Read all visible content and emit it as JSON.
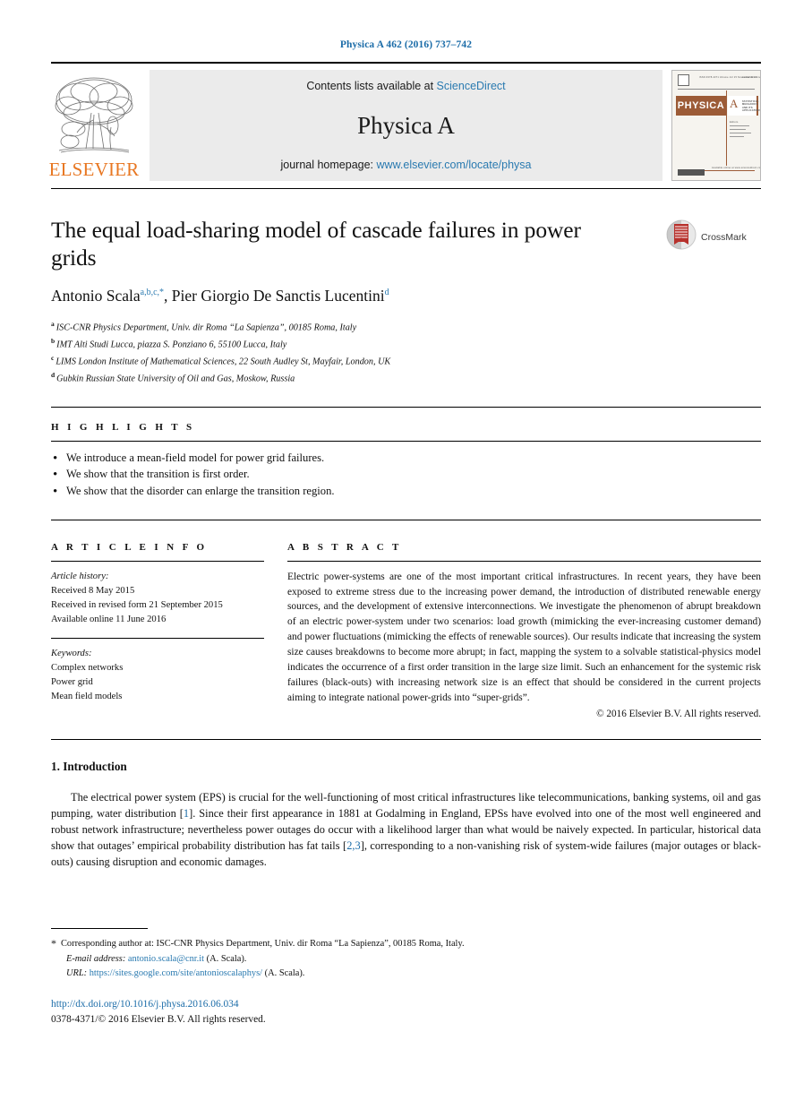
{
  "running_head": "Physica A 462 (2016) 737–742",
  "masthead": {
    "contents_prefix": "Contents lists available at ",
    "contents_link": "ScienceDirect",
    "journal_name": "Physica A",
    "homepage_prefix": "journal homepage: ",
    "homepage_link": "www.elsevier.com/locate/physa",
    "publisher_wordmark": "ELSEVIER",
    "cover_physica": "PHYSICA",
    "cover_letter": "A",
    "cover_subtitle": "STATISTICAL MECHANICS AND ITS APPLICATIONS"
  },
  "article": {
    "title": "The equal load-sharing model of cascade failures in power grids",
    "authors_plain": "Antonio Scala",
    "authors_mark_1": "a,b,c,*",
    "authors_second": ", Pier Giorgio De Sanctis Lucentini",
    "authors_mark_2": "d",
    "crossmark_label": "CrossMark",
    "affiliations": [
      {
        "mark": "a",
        "text": "ISC-CNR Physics Department, Univ. dir Roma “La Sapienza”, 00185 Roma, Italy"
      },
      {
        "mark": "b",
        "text": "IMT Alti Studi Lucca, piazza S. Ponziano 6, 55100 Lucca, Italy"
      },
      {
        "mark": "c",
        "text": "LIMS London Institute of Mathematical Sciences, 22 South Audley St, Mayfair, London, UK"
      },
      {
        "mark": "d",
        "text": "Gubkin Russian State University of Oil and Gas, Moskow, Russia"
      }
    ]
  },
  "highlights": {
    "heading": "H I G H L I G H T S",
    "items": [
      "We introduce a mean-field model for power grid failures.",
      "We show that the transition is first order.",
      "We show that the disorder can enlarge the transition region."
    ]
  },
  "article_info": {
    "heading": "A R T I C L E    I N F O",
    "history_label": "Article history:",
    "history_lines": [
      "Received 8 May 2015",
      "Received in revised form 21 September 2015",
      "Available online 11 June 2016"
    ],
    "keywords_label": "Keywords:",
    "keywords": [
      "Complex networks",
      "Power grid",
      "Mean field models"
    ]
  },
  "abstract": {
    "heading": "A B S T R A C T",
    "text": "Electric power-systems are one of the most important critical infrastructures. In recent years, they have been exposed to extreme stress due to the increasing power demand, the introduction of distributed renewable energy sources, and the development of extensive interconnections. We investigate the phenomenon of abrupt breakdown of an electric power-system under two scenarios: load growth (mimicking the ever-increasing customer demand) and power fluctuations (mimicking the effects of renewable sources). Our results indicate that increasing the system size causes breakdowns to become more abrupt; in fact, mapping the system to a solvable statistical-physics model indicates the occurrence of a first order transition in the large size limit. Such an enhancement for the systemic risk failures (black-outs) with increasing network size is an effect that should be considered in the current projects aiming to integrate national power-grids into “super-grids”.",
    "copyright": "© 2016 Elsevier B.V. All rights reserved."
  },
  "body": {
    "section_number_title": "1. Introduction",
    "paragraph_1a": "The electrical power system (EPS) is crucial for the well-functioning of most critical infrastructures like telecommunications, banking systems, oil and gas pumping, water distribution [",
    "cite_1": "1",
    "paragraph_1b": "]. Since their first appearance in 1881 at Godalming in England, EPSs have evolved into one of the most well engineered and robust network infrastructure; nevertheless power outages do occur with a likelihood larger than what would be naively expected. In particular, historical data show that outages’ empirical probability distribution has fat tails [",
    "cite_2": "2,3",
    "paragraph_1c": "], corresponding to a non-vanishing risk of system-wide failures (major outages or black-outs) causing disruption and economic damages."
  },
  "footnotes": {
    "corresponding": "Corresponding author at: ISC-CNR Physics Department, Univ. dir Roma “La Sapienza”, 00185 Roma, Italy.",
    "email_label": "E-mail address:",
    "email_value": "antonio.scala@cnr.it",
    "email_suffix": "(A. Scala).",
    "url_label": "URL:",
    "url_value": "https://sites.google.com/site/antonioscalaphys/",
    "url_suffix": "(A. Scala)."
  },
  "footer": {
    "doi": "http://dx.doi.org/10.1016/j.physa.2016.06.034",
    "issn_line": "0378-4371/© 2016 Elsevier B.V. All rights reserved."
  },
  "colors": {
    "link_blue": "#2a7ab0",
    "heading_blue": "#1b6ca8",
    "elsevier_orange": "#E87722",
    "masthead_gray": "#ebebeb",
    "crossmark_red": "#b7312c"
  }
}
